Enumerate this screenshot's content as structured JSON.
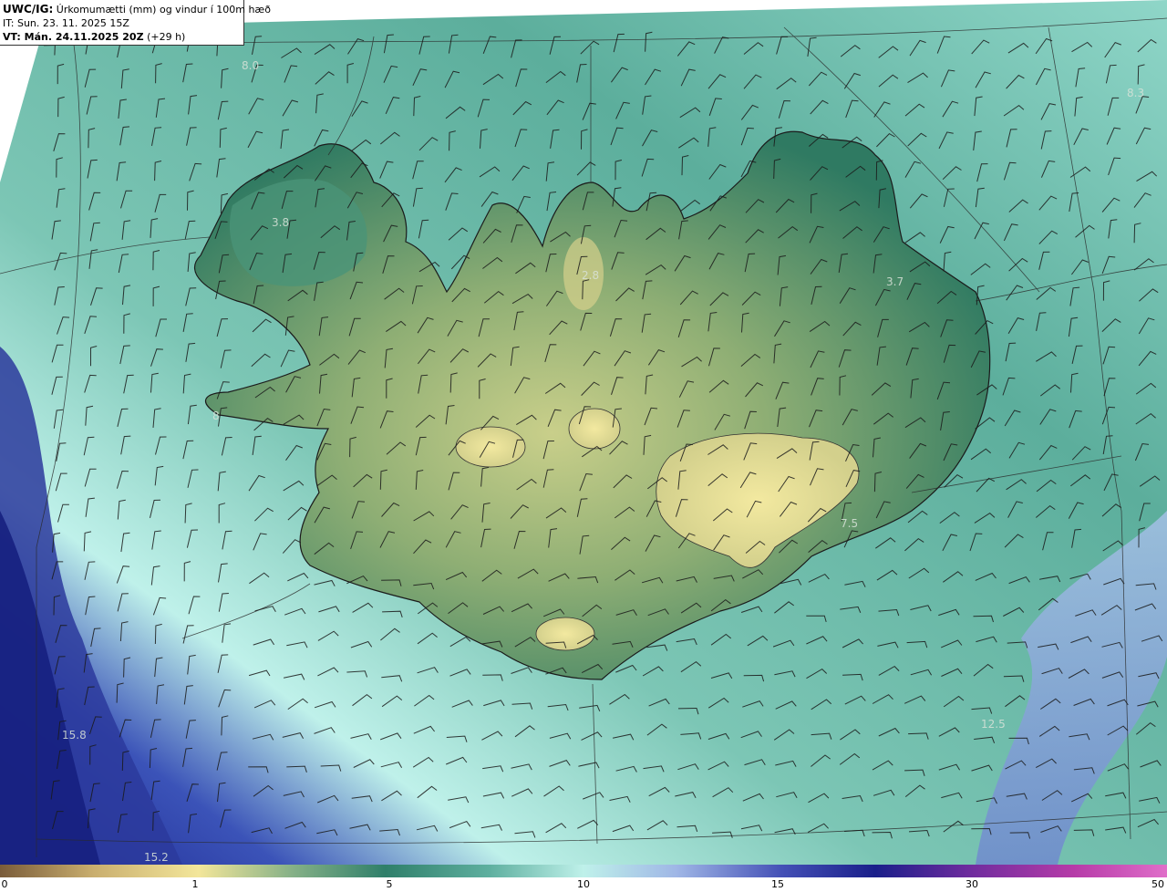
{
  "header": {
    "model": "UWC/IG:",
    "title": "Úrkomumætti (mm) og vindur í 100m hæð",
    "init_time": "IT: Sun. 23. 11. 2025 15Z",
    "valid_time": "VT: Mán. 24.11.2025 20Z",
    "valid_offset": "(+29 h)"
  },
  "map_values": [
    "8.0",
    "8.3",
    "3.8",
    "2.8",
    "3.7",
    "8",
    "7.5",
    "15.8",
    "12.5",
    "15.2"
  ],
  "colorbar": {
    "ticks": [
      "0",
      "1",
      "5",
      "10",
      "15",
      "30",
      "50"
    ],
    "colors": [
      "#7a5c3a",
      "#c9ae6e",
      "#f3e69a",
      "#86b187",
      "#2f7f6a",
      "#5fb0a0",
      "#bff1ea",
      "#9fb6e6",
      "#4450b6",
      "#1a1f8a",
      "#6e2c9e",
      "#b63ba8",
      "#e06ec9"
    ]
  }
}
